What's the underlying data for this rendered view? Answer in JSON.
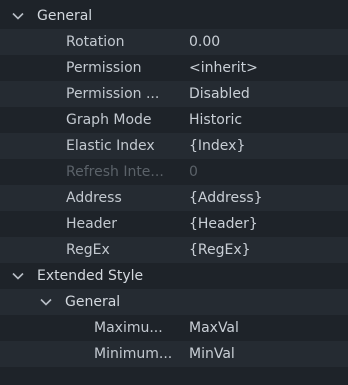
{
  "groups": {
    "general": {
      "label": "General"
    },
    "extended_style": {
      "label": "Extended Style"
    },
    "extended_general": {
      "label": "General"
    }
  },
  "properties": [
    {
      "name": "Rotation",
      "value": "0.00"
    },
    {
      "name": "Permission",
      "value": "<inherit>"
    },
    {
      "name": "Permission ...",
      "value": "Disabled"
    },
    {
      "name": "Graph Mode",
      "value": "Historic"
    },
    {
      "name": "Elastic Index",
      "value": "{Index}"
    },
    {
      "name": "Refresh Inte...",
      "value": "0",
      "disabled": true
    },
    {
      "name": "Address",
      "value": "{Address}"
    },
    {
      "name": "Header",
      "value": "{Header}"
    },
    {
      "name": "RegEx",
      "value": "{RegEx}"
    }
  ],
  "extended_properties": [
    {
      "name": "Maximu...",
      "value": "MaxVal"
    },
    {
      "name": "Minimum...",
      "value": "MinVal"
    }
  ],
  "icons": {
    "expand": "chevron-down-icon"
  },
  "colors": {
    "background": "#1e2329",
    "row_alt": "#252b32",
    "text": "#c9cfd6",
    "disabled_text": "#5b6269"
  }
}
